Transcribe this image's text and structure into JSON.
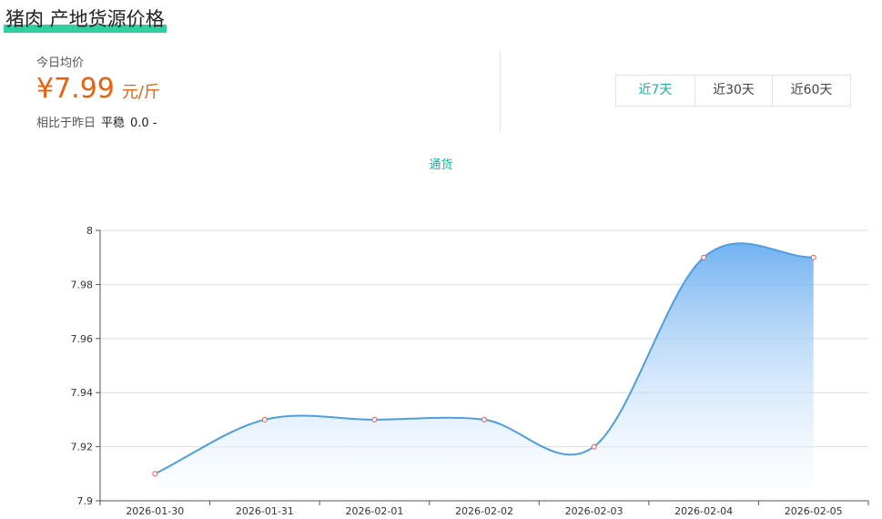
{
  "header": {
    "title": "猪肉 产地货源价格"
  },
  "price": {
    "avg_label": "今日均价",
    "value": "¥7.99",
    "unit": "元/斤",
    "compare_label": "相比于昨日",
    "compare_status": "平稳",
    "compare_value": "0.0",
    "compare_dash": "-"
  },
  "range_tabs": [
    {
      "label": "近7天",
      "active": true
    },
    {
      "label": "近30天",
      "active": false
    },
    {
      "label": "近60天",
      "active": false
    }
  ],
  "colors": {
    "accent": "#16b49c",
    "price": "#e8620f",
    "line": "#4f9ee0",
    "area_top": "#6aaef0",
    "marker": "#e05a5a"
  },
  "chart_data": {
    "type": "area",
    "legend": "通货",
    "x": [
      "2026-01-30",
      "2026-01-31",
      "2026-02-01",
      "2026-02-02",
      "2026-02-03",
      "2026-02-04",
      "2026-02-05"
    ],
    "series": [
      {
        "name": "通货",
        "values": [
          7.91,
          7.93,
          7.93,
          7.93,
          7.92,
          7.99,
          7.99
        ]
      }
    ],
    "yticks": [
      "7.9",
      "7.92",
      "7.94",
      "7.96",
      "7.98",
      "8"
    ],
    "ylim": [
      7.9,
      8.0
    ],
    "grid": true,
    "smooth": true
  }
}
